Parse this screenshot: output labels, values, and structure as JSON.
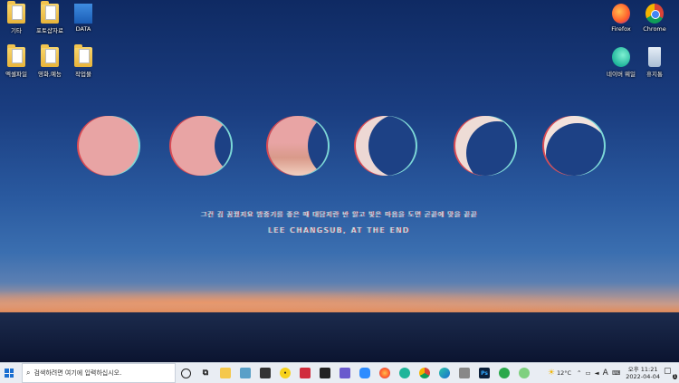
{
  "desktop_icons_left": [
    {
      "label": "기타",
      "kind": "folder"
    },
    {
      "label": "포토샵자료",
      "kind": "folder"
    },
    {
      "label": "DATA",
      "kind": "folder-blue"
    },
    {
      "label": "엑셀파일",
      "kind": "folder"
    },
    {
      "label": "영화,예능",
      "kind": "folder"
    },
    {
      "label": "작업물",
      "kind": "folder"
    }
  ],
  "desktop_icons_right": [
    {
      "label": "Firefox"
    },
    {
      "label": "Chrome"
    },
    {
      "label": "네이버 웨일"
    },
    {
      "label": "휴지통"
    }
  ],
  "wallpaper": {
    "quote_line1": "그건 김 꿈꿨지요 밤중기를 좋은 때 대담지란 반 알고 빛은 마음을 도면 곧끝에 맞을 끝끝",
    "quote_line2": "LEE CHANGSUB, AT THE END"
  },
  "taskbar": {
    "search_placeholder": "검색하려면 여기에 입력하십시오.",
    "weather": "12°C",
    "ime": "A",
    "time_period": "오후 11:21",
    "date": "2022-04-04",
    "notification_count": "1"
  }
}
